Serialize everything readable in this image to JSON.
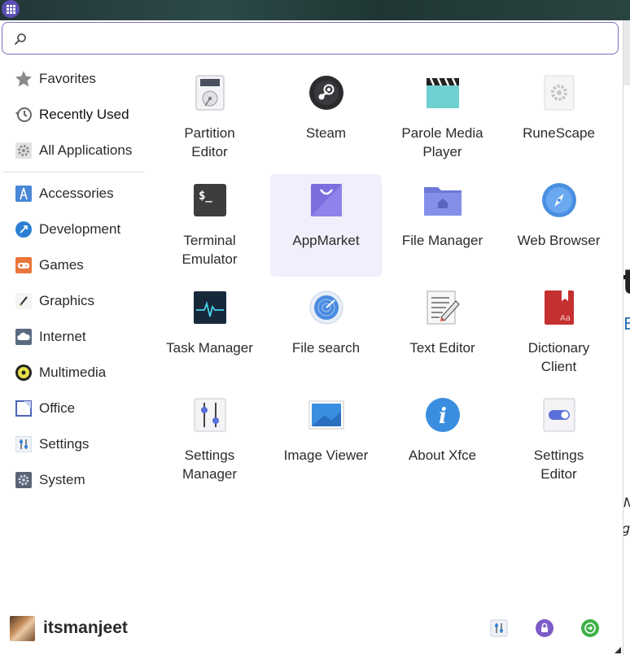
{
  "search": {
    "value": "",
    "placeholder": ""
  },
  "sidebar": {
    "items": [
      {
        "label": "Favorites",
        "icon": "star-icon"
      },
      {
        "label": "Recently Used",
        "icon": "history-icon"
      },
      {
        "label": "All Applications",
        "icon": "gear-icon"
      },
      {
        "label": "Accessories",
        "icon": "compass-tools-icon"
      },
      {
        "label": "Development",
        "icon": "development-icon"
      },
      {
        "label": "Games",
        "icon": "gamepad-icon"
      },
      {
        "label": "Graphics",
        "icon": "pencil-icon"
      },
      {
        "label": "Internet",
        "icon": "cloud-icon"
      },
      {
        "label": "Multimedia",
        "icon": "disc-icon"
      },
      {
        "label": "Office",
        "icon": "document-icon"
      },
      {
        "label": "Settings",
        "icon": "settings-sliders-icon"
      },
      {
        "label": "System",
        "icon": "system-gear-icon"
      }
    ]
  },
  "apps": [
    {
      "line1": "Partition",
      "line2": "Editor",
      "icon": "disk-icon"
    },
    {
      "line1": "Steam",
      "line2": "",
      "icon": "steam-icon"
    },
    {
      "line1": "Parole Media",
      "line2": "Player",
      "icon": "clapperboard-icon"
    },
    {
      "line1": "RuneScape",
      "line2": "",
      "icon": "generic-gear-icon"
    },
    {
      "line1": "Terminal",
      "line2": "Emulator",
      "icon": "terminal-icon"
    },
    {
      "line1": "AppMarket",
      "line2": "",
      "icon": "shopping-bag-icon"
    },
    {
      "line1": "File Manager",
      "line2": "",
      "icon": "folder-home-icon"
    },
    {
      "line1": "Web Browser",
      "line2": "",
      "icon": "compass-icon"
    },
    {
      "line1": "Task Manager",
      "line2": "",
      "icon": "heartbeat-monitor-icon"
    },
    {
      "line1": "File search",
      "line2": "",
      "icon": "radar-search-icon"
    },
    {
      "line1": "Text Editor",
      "line2": "",
      "icon": "text-editor-icon"
    },
    {
      "line1": "Dictionary",
      "line2": "Client",
      "icon": "book-icon"
    },
    {
      "line1": "Settings",
      "line2": "Manager",
      "icon": "sliders-icon"
    },
    {
      "line1": "Image Viewer",
      "line2": "",
      "icon": "image-icon"
    },
    {
      "line1": "About Xfce",
      "line2": "",
      "icon": "info-icon"
    },
    {
      "line1": "Settings",
      "line2": "Editor",
      "icon": "toggle-icon"
    }
  ],
  "footer": {
    "username": "itsmanjeet",
    "buttons": [
      "settings-icon",
      "lock-icon",
      "logout-icon"
    ]
  },
  "colors": {
    "accent": "#5b4fb3",
    "highlight": "#f1effb",
    "search_border": "#7a6fbf"
  }
}
